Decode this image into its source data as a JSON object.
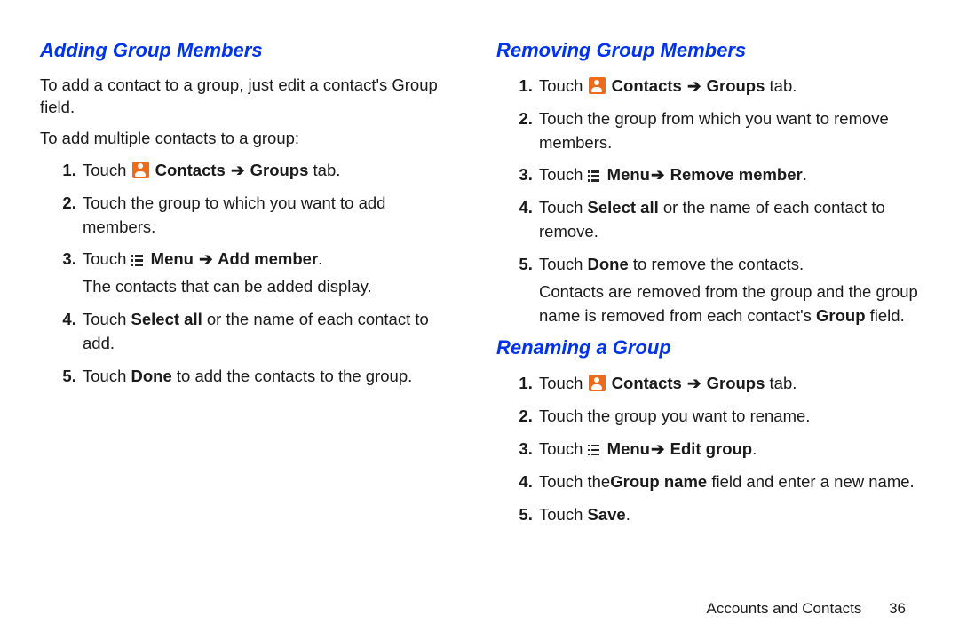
{
  "left": {
    "heading": "Adding Group Members",
    "intro1": "To add a contact to a group, just edit a contact's Group field.",
    "intro2": "To add multiple contacts to a group:",
    "s1a": "Touch ",
    "s1b": " Contacts ",
    "s1c": " Groups",
    "s1d": " tab.",
    "s2": "Touch the group to which you want to add members.",
    "s3a": "Touch ",
    "s3b": " Menu ",
    "s3c": " Add member",
    "s3d": ".",
    "s3sub": "The contacts that can be added display.",
    "s4a": "Touch ",
    "s4b": "Select all",
    "s4c": " or the name of each contact to add.",
    "s5a": "Touch ",
    "s5b": "Done",
    "s5c": " to add the contacts to the group."
  },
  "removing": {
    "heading": "Removing Group Members",
    "s1a": "Touch ",
    "s1b": " Contacts ",
    "s1c": " Groups",
    "s1d": " tab.",
    "s2": "Touch the group from which you want to remove members.",
    "s3a": "Touch ",
    "s3b": " Menu",
    "s3c": "  Remove member",
    "s3d": ".",
    "s4a": "Touch ",
    "s4b": "Select all",
    "s4c": " or the name of each contact to remove.",
    "s5a": "Touch ",
    "s5b": "Done",
    "s5c": " to remove the contacts.",
    "s5suba": "Contacts are removed from the group and the group name is removed from each contact's ",
    "s5subb": "Group",
    "s5subc": " field."
  },
  "renaming": {
    "heading": "Renaming a Group",
    "s1a": "Touch ",
    "s1b": " Contacts ",
    "s1c": " Groups",
    "s1d": " tab.",
    "s2": "Touch the group you want to rename.",
    "s3a": "Touch ",
    "s3b": " Menu",
    "s3c": "  Edit group",
    "s3d": ".",
    "s4a": "Touch the",
    "s4b": "Group name ",
    "s4c": " field and enter a new name.",
    "s5a": "Touch ",
    "s5b": "Save",
    "s5c": "."
  },
  "arrow": "➔",
  "footer_label": "Accounts and Contacts",
  "footer_page": "36"
}
